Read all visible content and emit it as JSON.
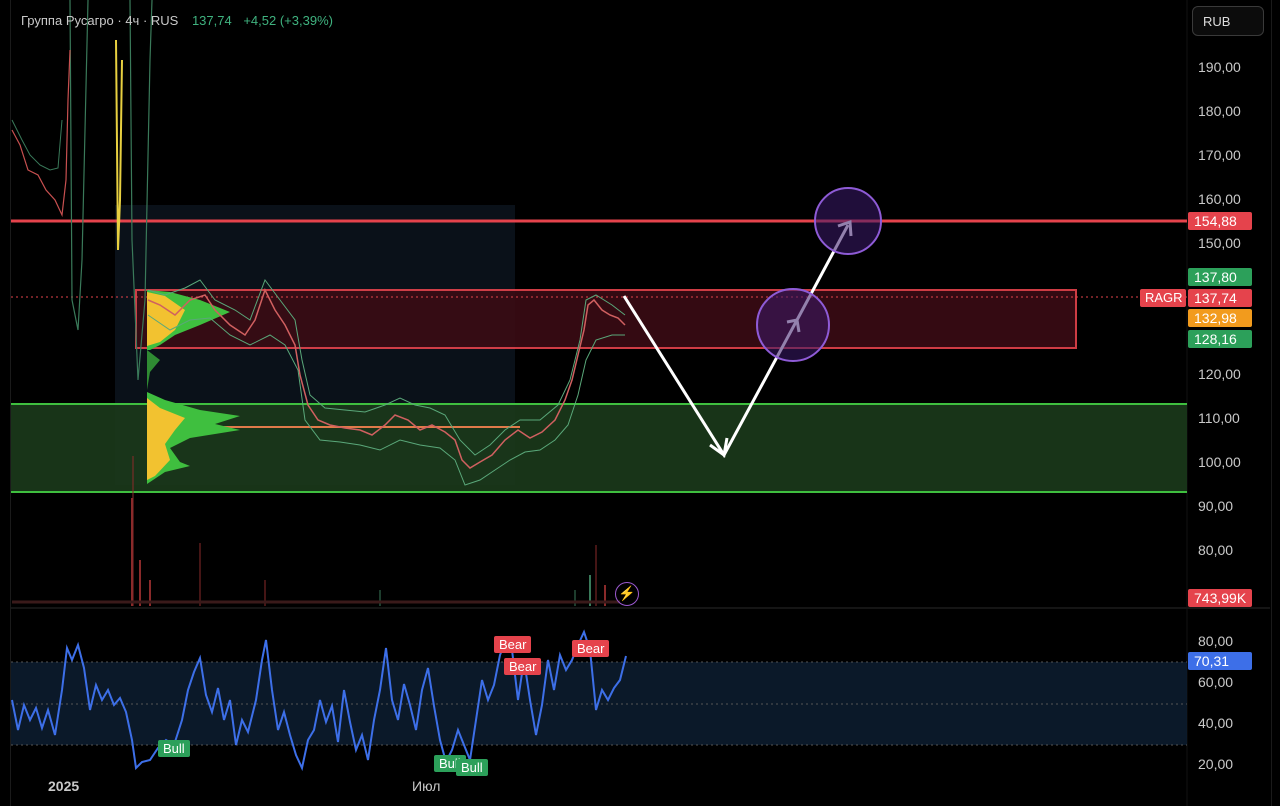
{
  "header": {
    "symbol": "Группа Русагро · 4ч · RUS",
    "price": "137,74",
    "change": "+4,52 (+3,39%)"
  },
  "currency": "RUB",
  "price_axis": [
    "190,00",
    "180,00",
    "170,00",
    "160,00",
    "150,00",
    "120,00",
    "110,00",
    "100,00",
    "90,00",
    "80,00"
  ],
  "price_tags": {
    "resistance": "154,88",
    "high": "137,80",
    "last": "137,74",
    "mid": "132,98",
    "low": "128,16",
    "volume": "743,99K",
    "symbol": "RAGR"
  },
  "oscillator": {
    "axis": [
      "80,00",
      "60,00",
      "40,00",
      "20,00"
    ],
    "value": "70,31",
    "signals": {
      "bear": "Bear",
      "bull": "Bull"
    }
  },
  "time_axis": {
    "year": "2025",
    "month": "Июл"
  },
  "colors": {
    "background": "#000000",
    "resistance": "#e5434c",
    "support_zone": "#3fbf3f",
    "rsi_line": "#3d6fe8",
    "accent_purple": "#8e5bd6"
  },
  "icons": {
    "alert": "lightning-bolt-icon"
  }
}
